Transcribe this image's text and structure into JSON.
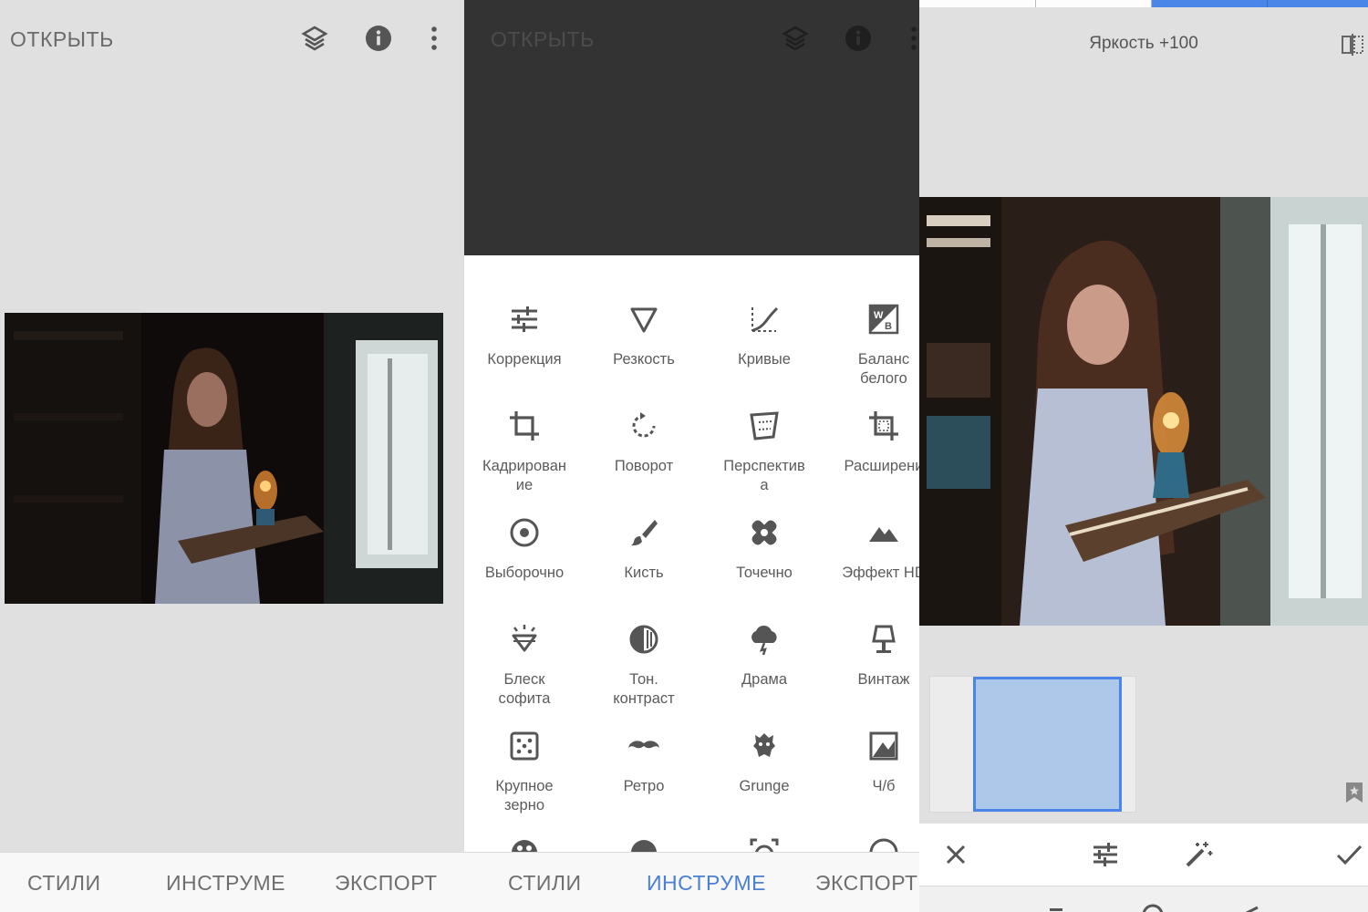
{
  "left_panel": {
    "open_label": "ОТКРЫТЬ",
    "nav": [
      "СТИЛИ",
      "ИНСТРУМЕ",
      "ЭКСПОРТ"
    ]
  },
  "middle_panel": {
    "open_label": "ОТКРЫТЬ",
    "tools": [
      {
        "label": "Коррекция",
        "icon": "sliders-icon"
      },
      {
        "label": "Резкость",
        "icon": "triangle-down-icon"
      },
      {
        "label": "Кривые",
        "icon": "curves-icon"
      },
      {
        "label": "Баланс\nбелого",
        "icon": "white-balance-icon"
      },
      {
        "label": "Кадрирован\nие",
        "icon": "crop-icon"
      },
      {
        "label": "Поворот",
        "icon": "rotate-icon"
      },
      {
        "label": "Перспектив\nа",
        "icon": "perspective-icon"
      },
      {
        "label": "Расширени",
        "icon": "expand-icon"
      },
      {
        "label": "Выборочно",
        "icon": "target-icon"
      },
      {
        "label": "Кисть",
        "icon": "brush-icon"
      },
      {
        "label": "Точечно",
        "icon": "healing-icon"
      },
      {
        "label": "Эффект HD",
        "icon": "mountain-icon"
      },
      {
        "label": "Блеск\nсофита",
        "icon": "diamond-icon"
      },
      {
        "label": "Тон.\nконтраст",
        "icon": "tonal-contrast-icon"
      },
      {
        "label": "Драма",
        "icon": "cloud-lightning-icon"
      },
      {
        "label": "Винтаж",
        "icon": "lamp-icon"
      },
      {
        "label": "Крупное\nзерно",
        "icon": "dice-icon"
      },
      {
        "label": "Ретро",
        "icon": "mustache-icon"
      },
      {
        "label": "Grunge",
        "icon": "grunge-icon"
      },
      {
        "label": "Ч/б",
        "icon": "bw-icon"
      }
    ],
    "nav": [
      "СТИЛИ",
      "ИНСТРУМЕ",
      "ЭКСПОРТ"
    ],
    "active_tab": 1
  },
  "right_panel": {
    "brightness_label": "Яркость +100"
  },
  "colors": {
    "accent": "#4a86e8",
    "thumb_fill": "#aec8ea",
    "panel_bg": "#e0e0e0",
    "dark_bg": "#333333"
  }
}
